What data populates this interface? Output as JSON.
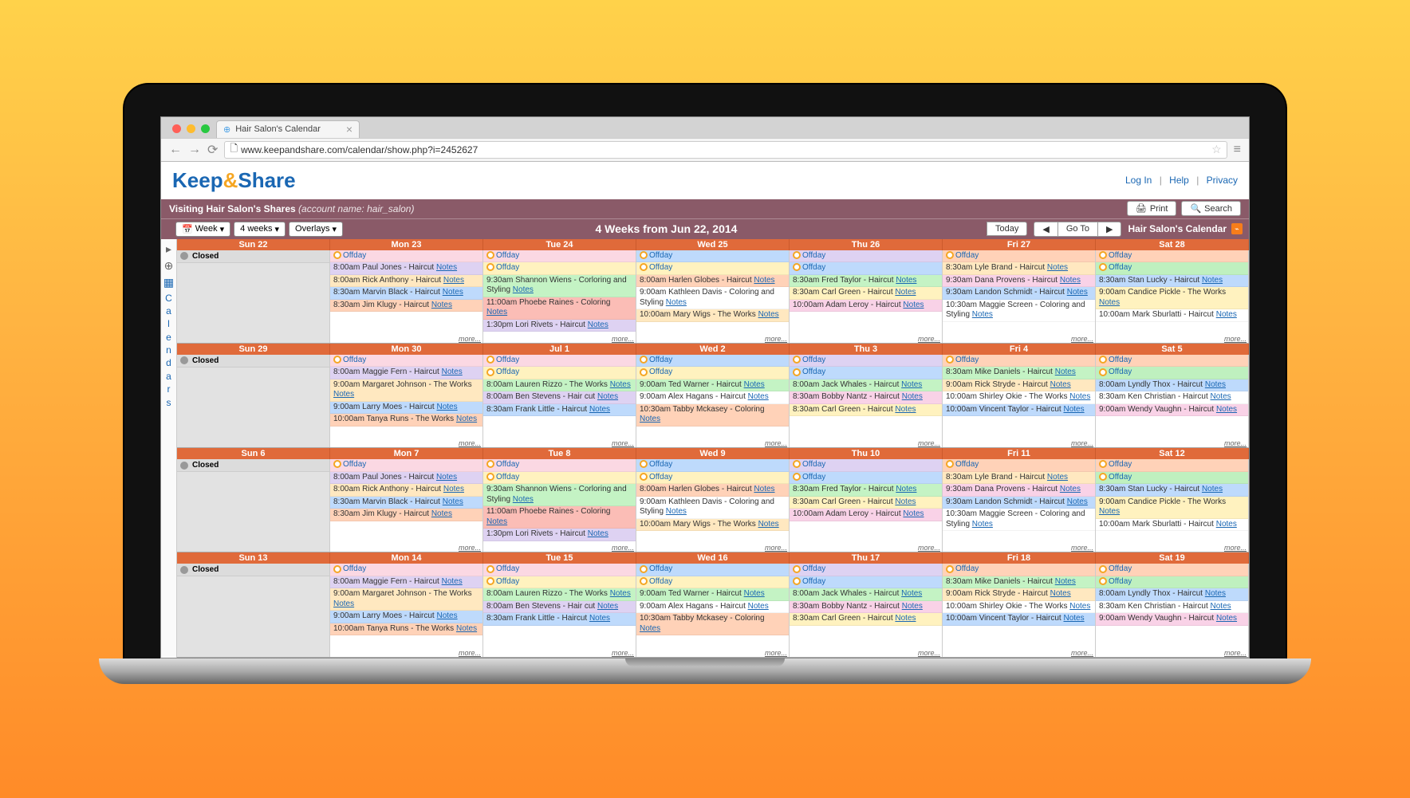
{
  "browser": {
    "tab_title": "Hair Salon's Calendar",
    "url": "www.keepandshare.com/calendar/show.php?i=2452627"
  },
  "header": {
    "logo": {
      "keep": "Keep",
      "amp": "&",
      "share": "Share"
    },
    "links": {
      "login": "Log In",
      "help": "Help",
      "privacy": "Privacy"
    }
  },
  "visit_bar": {
    "text_bold": "Visiting Hair Salon's Shares",
    "text_italic": "(account name: hair_salon)",
    "print": "Print",
    "search": "Search"
  },
  "toolbar": {
    "week": "Week",
    "four_weeks": "4 weeks",
    "overlays": "Overlays",
    "title": "4 Weeks from Jun 22, 2014",
    "today": "Today",
    "goto": "Go To",
    "cal_name": "Hair Salon's Calendar"
  },
  "sidebar": {
    "label": "Calendars"
  },
  "labels": {
    "closed": "Closed",
    "offday": "Offday",
    "notes": "Notes",
    "more": "more..."
  },
  "weeks": [
    {
      "headers": [
        "Sun 22",
        "Mon 23",
        "Tue 24",
        "Wed 25",
        "Thu 26",
        "Fri 27",
        "Sat 28"
      ],
      "days": [
        {
          "closed": true,
          "events": []
        },
        {
          "events": [
            {
              "c": "c-offpink",
              "off": true
            },
            {
              "c": "c-lav",
              "t": "8:00am Paul Jones - Haircut ",
              "n": true
            },
            {
              "c": "c-tan",
              "t": "8:00am Rick Anthony - Haircut ",
              "n": true
            },
            {
              "c": "c-blue",
              "t": "8:30am Marvin Black - Haircut ",
              "n": true
            },
            {
              "c": "c-peach",
              "t": "8:30am Jim Klugy - Haircut ",
              "n": true
            }
          ]
        },
        {
          "events": [
            {
              "c": "c-offpink",
              "off": true
            },
            {
              "c": "c-yellow",
              "off": true
            },
            {
              "c": "c-green",
              "t": "9:30am Shannon Wiens - Corloring and Styling ",
              "n": true
            },
            {
              "c": "c-salmon",
              "t": "11:00am Phoebe Raines - Coloring ",
              "n": true
            },
            {
              "c": "c-lav",
              "t": "1:30pm Lori Rivets - Haircut ",
              "n": true
            }
          ]
        },
        {
          "events": [
            {
              "c": "c-blue",
              "off": true
            },
            {
              "c": "c-yellow",
              "off": true
            },
            {
              "c": "c-peach",
              "t": "8:00am Harlen Globes - Haircut ",
              "n": true
            },
            {
              "c": "c-white",
              "t": "9:00am Kathleen Davis - Coloring and Styling ",
              "n": true
            },
            {
              "c": "c-tan",
              "t": "10:00am Mary Wigs - The Works ",
              "n": true
            }
          ]
        },
        {
          "events": [
            {
              "c": "c-lav",
              "off": true
            },
            {
              "c": "c-blue",
              "off": true
            },
            {
              "c": "c-green",
              "t": "8:30am Fred Taylor - Haircut ",
              "n": true
            },
            {
              "c": "c-yellow",
              "t": "8:30am Carl Green - Haircut ",
              "n": true
            },
            {
              "c": "c-pink",
              "t": "10:00am Adam Leroy - Haircut ",
              "n": true
            }
          ]
        },
        {
          "events": [
            {
              "c": "c-peach",
              "off": true
            },
            {
              "c": "c-tan",
              "t": "8:30am Lyle Brand - Haircut ",
              "n": true
            },
            {
              "c": "c-pink",
              "t": "9:30am Dana Provens - Haircut ",
              "n": true
            },
            {
              "c": "c-blue",
              "t": "9:30am Landon Schmidt - Haircut ",
              "n": true
            },
            {
              "c": "c-white",
              "t": "10:30am Maggie Screen - Coloring and Styling ",
              "n": true
            }
          ]
        },
        {
          "events": [
            {
              "c": "c-peach",
              "off": true
            },
            {
              "c": "c-offgreen",
              "off": true
            },
            {
              "c": "c-blue",
              "t": "8:30am Stan Lucky - Haircut ",
              "n": true
            },
            {
              "c": "c-yellow",
              "t": "9:00am Candice Pickle - The Works ",
              "n": true
            },
            {
              "c": "c-white",
              "t": "10:00am Mark Sburlatti - Haircut ",
              "n": true
            }
          ]
        }
      ]
    },
    {
      "headers": [
        "Sun 29",
        "Mon 30",
        "Jul 1",
        "Wed 2",
        "Thu 3",
        "Fri 4",
        "Sat 5"
      ],
      "days": [
        {
          "closed": true
        },
        {
          "events": [
            {
              "c": "c-offpink",
              "off": true
            },
            {
              "c": "c-lav",
              "t": "8:00am Maggie Fern - Haircut ",
              "n": true
            },
            {
              "c": "c-tan",
              "t": "9:00am Margaret Johnson - The Works ",
              "n": true
            },
            {
              "c": "c-blue",
              "t": "9:00am Larry Moes - Haircut ",
              "n": true
            },
            {
              "c": "c-peach",
              "t": "10:00am Tanya Runs - The Works ",
              "n": true
            }
          ]
        },
        {
          "events": [
            {
              "c": "c-offpink",
              "off": true
            },
            {
              "c": "c-yellow",
              "off": true
            },
            {
              "c": "c-green",
              "t": "8:00am Lauren Rizzo - The Works ",
              "n": true
            },
            {
              "c": "c-lav",
              "t": "8:00am Ben Stevens - Hair cut ",
              "n": true
            },
            {
              "c": "c-blue",
              "t": "8:30am Frank Little - Haircut ",
              "n": true
            }
          ]
        },
        {
          "events": [
            {
              "c": "c-blue",
              "off": true
            },
            {
              "c": "c-yellow",
              "off": true
            },
            {
              "c": "c-green",
              "t": "9:00am Ted Warner - Haircut ",
              "n": true
            },
            {
              "c": "c-white",
              "t": "9:00am Alex Hagans - Haircut ",
              "n": true
            },
            {
              "c": "c-peach",
              "t": "10:30am Tabby Mckasey - Coloring ",
              "n": true
            }
          ]
        },
        {
          "events": [
            {
              "c": "c-lav",
              "off": true
            },
            {
              "c": "c-blue",
              "off": true
            },
            {
              "c": "c-green",
              "t": "8:00am Jack Whales - Haircut ",
              "n": true
            },
            {
              "c": "c-pink",
              "t": "8:30am Bobby Nantz - Haircut ",
              "n": true
            },
            {
              "c": "c-yellow",
              "t": "8:30am Carl Green - Haircut ",
              "n": true
            }
          ]
        },
        {
          "events": [
            {
              "c": "c-peach",
              "off": true
            },
            {
              "c": "c-green",
              "t": "8:30am Mike Daniels - Haircut ",
              "n": true
            },
            {
              "c": "c-tan",
              "t": "9:00am Rick Stryde - Haircut ",
              "n": true
            },
            {
              "c": "c-white",
              "t": "10:00am Shirley Okie - The Works ",
              "n": true
            },
            {
              "c": "c-blue",
              "t": "10:00am Vincent Taylor - Haircut ",
              "n": true
            }
          ]
        },
        {
          "events": [
            {
              "c": "c-peach",
              "off": true
            },
            {
              "c": "c-offgreen",
              "off": true
            },
            {
              "c": "c-blue",
              "t": "8:00am Lyndly Thox - Haircut ",
              "n": true
            },
            {
              "c": "c-white",
              "t": "8:30am Ken Christian - Haircut ",
              "n": true
            },
            {
              "c": "c-pink",
              "t": "9:00am Wendy Vaughn - Haircut ",
              "n": true
            }
          ]
        }
      ]
    },
    {
      "headers": [
        "Sun 6",
        "Mon 7",
        "Tue 8",
        "Wed 9",
        "Thu 10",
        "Fri 11",
        "Sat 12"
      ],
      "days": [
        {
          "closed": true
        },
        {
          "events": [
            {
              "c": "c-offpink",
              "off": true
            },
            {
              "c": "c-lav",
              "t": "8:00am Paul Jones - Haircut ",
              "n": true
            },
            {
              "c": "c-tan",
              "t": "8:00am Rick Anthony - Haircut ",
              "n": true
            },
            {
              "c": "c-blue",
              "t": "8:30am Marvin Black - Haircut ",
              "n": true
            },
            {
              "c": "c-peach",
              "t": "8:30am Jim Klugy - Haircut ",
              "n": true
            }
          ]
        },
        {
          "events": [
            {
              "c": "c-offpink",
              "off": true
            },
            {
              "c": "c-yellow",
              "off": true
            },
            {
              "c": "c-green",
              "t": "9:30am Shannon Wiens - Corloring and Styling ",
              "n": true
            },
            {
              "c": "c-salmon",
              "t": "11:00am Phoebe Raines - Coloring ",
              "n": true
            },
            {
              "c": "c-lav",
              "t": "1:30pm Lori Rivets - Haircut ",
              "n": true
            }
          ]
        },
        {
          "events": [
            {
              "c": "c-blue",
              "off": true
            },
            {
              "c": "c-yellow",
              "off": true
            },
            {
              "c": "c-peach",
              "t": "8:00am Harlen Globes - Haircut ",
              "n": true
            },
            {
              "c": "c-white",
              "t": "9:00am Kathleen Davis - Coloring and Styling ",
              "n": true
            },
            {
              "c": "c-tan",
              "t": "10:00am Mary Wigs - The Works ",
              "n": true
            }
          ]
        },
        {
          "events": [
            {
              "c": "c-lav",
              "off": true
            },
            {
              "c": "c-blue",
              "off": true
            },
            {
              "c": "c-green",
              "t": "8:30am Fred Taylor - Haircut ",
              "n": true
            },
            {
              "c": "c-yellow",
              "t": "8:30am Carl Green - Haircut ",
              "n": true
            },
            {
              "c": "c-pink",
              "t": "10:00am Adam Leroy - Haircut ",
              "n": true
            }
          ]
        },
        {
          "events": [
            {
              "c": "c-peach",
              "off": true
            },
            {
              "c": "c-tan",
              "t": "8:30am Lyle Brand - Haircut ",
              "n": true
            },
            {
              "c": "c-pink",
              "t": "9:30am Dana Provens - Haircut ",
              "n": true
            },
            {
              "c": "c-blue",
              "t": "9:30am Landon Schmidt - Haircut ",
              "n": true
            },
            {
              "c": "c-white",
              "t": "10:30am Maggie Screen - Coloring and Styling ",
              "n": true
            }
          ]
        },
        {
          "events": [
            {
              "c": "c-peach",
              "off": true
            },
            {
              "c": "c-offgreen",
              "off": true
            },
            {
              "c": "c-blue",
              "t": "8:30am Stan Lucky - Haircut ",
              "n": true
            },
            {
              "c": "c-yellow",
              "t": "9:00am Candice Pickle - The Works ",
              "n": true
            },
            {
              "c": "c-white",
              "t": "10:00am Mark Sburlatti - Haircut ",
              "n": true
            }
          ]
        }
      ]
    },
    {
      "headers": [
        "Sun 13",
        "Mon 14",
        "Tue 15",
        "Wed 16",
        "Thu 17",
        "Fri 18",
        "Sat 19"
      ],
      "days": [
        {
          "closed": true
        },
        {
          "events": [
            {
              "c": "c-offpink",
              "off": true
            },
            {
              "c": "c-lav",
              "t": "8:00am Maggie Fern - Haircut ",
              "n": true
            },
            {
              "c": "c-tan",
              "t": "9:00am Margaret Johnson - The Works ",
              "n": true
            },
            {
              "c": "c-blue",
              "t": "9:00am Larry Moes - Haircut ",
              "n": true
            },
            {
              "c": "c-peach",
              "t": "10:00am Tanya Runs - The Works ",
              "n": true
            }
          ]
        },
        {
          "events": [
            {
              "c": "c-offpink",
              "off": true
            },
            {
              "c": "c-yellow",
              "off": true
            },
            {
              "c": "c-green",
              "t": "8:00am Lauren Rizzo - The Works ",
              "n": true
            },
            {
              "c": "c-lav",
              "t": "8:00am Ben Stevens - Hair cut ",
              "n": true
            },
            {
              "c": "c-blue",
              "t": "8:30am Frank Little - Haircut ",
              "n": true
            }
          ]
        },
        {
          "events": [
            {
              "c": "c-blue",
              "off": true
            },
            {
              "c": "c-yellow",
              "off": true
            },
            {
              "c": "c-green",
              "t": "9:00am Ted Warner - Haircut ",
              "n": true
            },
            {
              "c": "c-white",
              "t": "9:00am Alex Hagans - Haircut ",
              "n": true
            },
            {
              "c": "c-peach",
              "t": "10:30am Tabby Mckasey - Coloring ",
              "n": true
            }
          ]
        },
        {
          "events": [
            {
              "c": "c-lav",
              "off": true
            },
            {
              "c": "c-blue",
              "off": true
            },
            {
              "c": "c-green",
              "t": "8:00am Jack Whales - Haircut ",
              "n": true
            },
            {
              "c": "c-pink",
              "t": "8:30am Bobby Nantz - Haircut ",
              "n": true
            },
            {
              "c": "c-yellow",
              "t": "8:30am Carl Green - Haircut ",
              "n": true
            }
          ]
        },
        {
          "events": [
            {
              "c": "c-peach",
              "off": true
            },
            {
              "c": "c-green",
              "t": "8:30am Mike Daniels - Haircut ",
              "n": true
            },
            {
              "c": "c-tan",
              "t": "9:00am Rick Stryde - Haircut ",
              "n": true
            },
            {
              "c": "c-white",
              "t": "10:00am Shirley Okie - The Works ",
              "n": true
            },
            {
              "c": "c-blue",
              "t": "10:00am Vincent Taylor - Haircut ",
              "n": true
            }
          ]
        },
        {
          "events": [
            {
              "c": "c-peach",
              "off": true
            },
            {
              "c": "c-offgreen",
              "off": true
            },
            {
              "c": "c-blue",
              "t": "8:00am Lyndly Thox - Haircut ",
              "n": true
            },
            {
              "c": "c-white",
              "t": "8:30am Ken Christian - Haircut ",
              "n": true
            },
            {
              "c": "c-pink",
              "t": "9:00am Wendy Vaughn - Haircut ",
              "n": true
            }
          ]
        }
      ]
    }
  ]
}
